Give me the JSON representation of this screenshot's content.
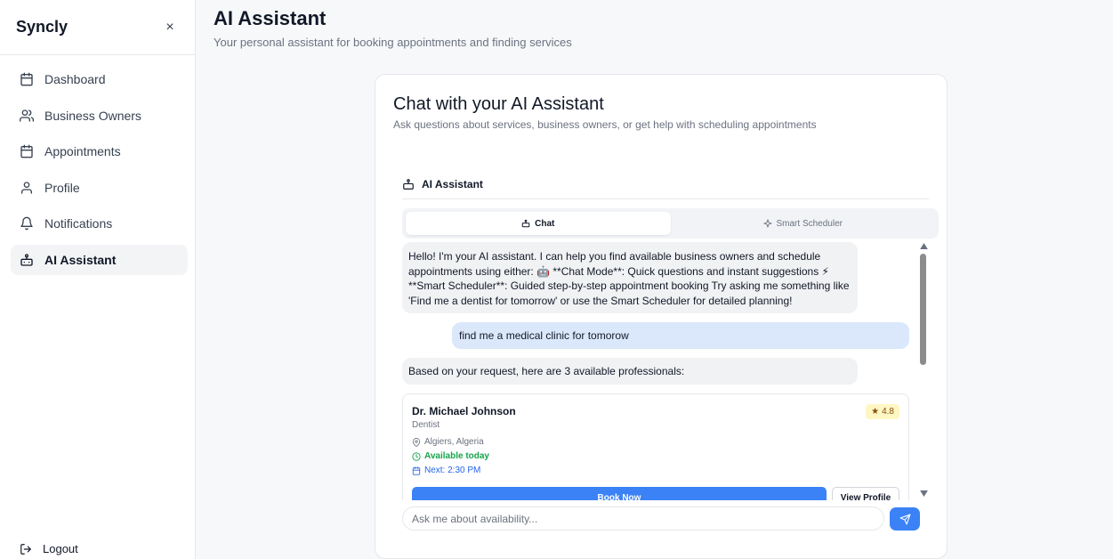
{
  "sidebar": {
    "brand": "Syncly",
    "close_label": "×",
    "items": [
      {
        "label": "Dashboard",
        "icon": "calendar-icon",
        "active": false
      },
      {
        "label": "Business Owners",
        "icon": "users-icon",
        "active": false
      },
      {
        "label": "Appointments",
        "icon": "calendar-icon",
        "active": false
      },
      {
        "label": "Profile",
        "icon": "user-icon",
        "active": false
      },
      {
        "label": "Notifications",
        "icon": "bell-icon",
        "active": false
      },
      {
        "label": "AI Assistant",
        "icon": "bot-icon",
        "active": true
      }
    ],
    "logout_label": "Logout"
  },
  "header": {
    "title": "AI Assistant",
    "subtitle": "Your personal assistant for booking appointments and finding services"
  },
  "chat_card": {
    "title": "Chat with your AI Assistant",
    "subtitle": "Ask questions about services, business owners, or get help with scheduling appointments",
    "assistant_label": "AI Assistant",
    "tabs": [
      {
        "label": "Chat",
        "icon": "bot-icon",
        "active": true
      },
      {
        "label": "Smart Scheduler",
        "icon": "sparkle-icon",
        "active": false
      }
    ],
    "messages": [
      {
        "role": "assistant",
        "text": "Hello! I'm your AI assistant. I can help you find available business owners and schedule appointments using either: 🤖 **Chat Mode**: Quick questions and instant suggestions ⚡ **Smart Scheduler**: Guided step-by-step appointment booking Try asking me something like 'Find me a dentist for tomorrow' or use the Smart Scheduler for detailed planning!"
      },
      {
        "role": "user",
        "text": "find me a medical clinic for tomorow"
      },
      {
        "role": "assistant",
        "text": "Based on your request, here are 3 available professionals:"
      }
    ],
    "professional": {
      "name": "Dr. Michael Johnson",
      "specialty": "Dentist",
      "rating": "4.8",
      "location": "Algiers, Algeria",
      "availability": "Available today",
      "next_slot": "Next: 2:30 PM",
      "book_label": "Book Now",
      "view_label": "View Profile"
    },
    "input_placeholder": "Ask me about availability...",
    "send_icon": "send-icon"
  },
  "colors": {
    "accent": "#3b82f6",
    "user_bubble": "#dbe8fb",
    "bot_bubble": "#f1f2f4",
    "available": "#16a34a",
    "rating_bg": "#fef7c3"
  }
}
